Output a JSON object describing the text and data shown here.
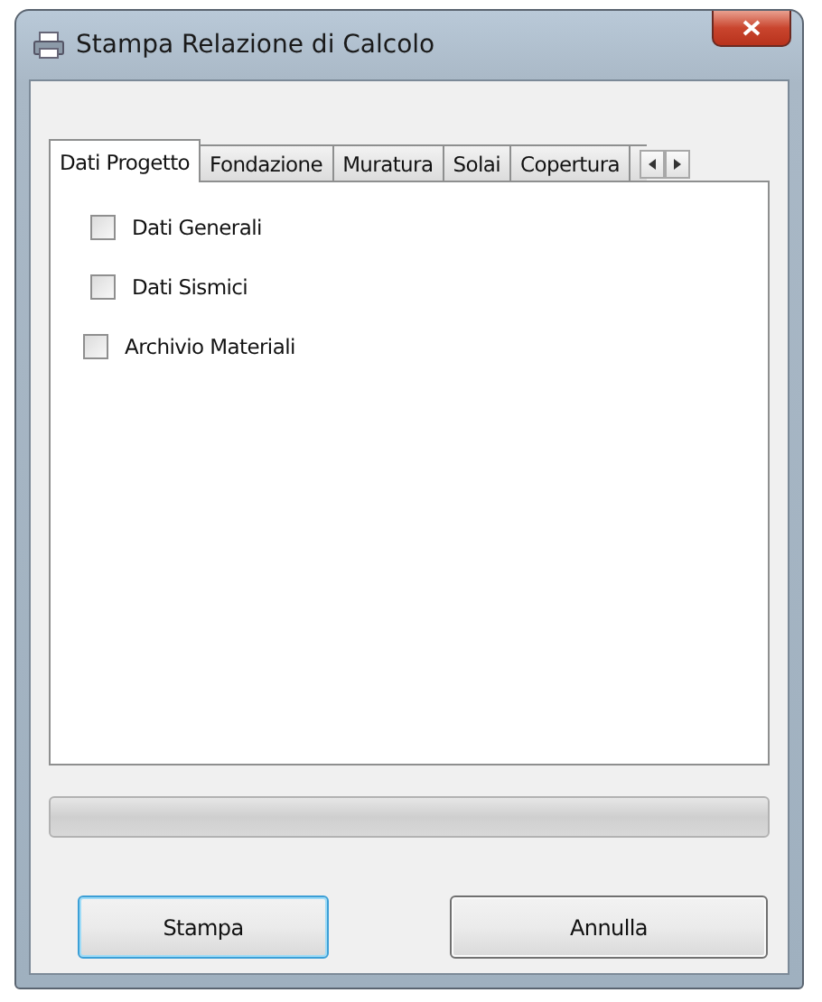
{
  "window": {
    "title": "Stampa Relazione di Calcolo"
  },
  "tabs": [
    {
      "label": "Dati Progetto",
      "selected": true
    },
    {
      "label": "Fondazione",
      "selected": false
    },
    {
      "label": "Muratura",
      "selected": false
    },
    {
      "label": "Solai",
      "selected": false
    },
    {
      "label": "Copertura",
      "selected": false
    }
  ],
  "options": [
    {
      "label": "Dati Generali",
      "checked": false
    },
    {
      "label": "Dati Sismici",
      "checked": false
    },
    {
      "label": "Archivio Materiali",
      "checked": false
    }
  ],
  "buttons": [
    {
      "label": "Stampa",
      "default": true
    },
    {
      "label": "Annulla",
      "default": false
    }
  ]
}
